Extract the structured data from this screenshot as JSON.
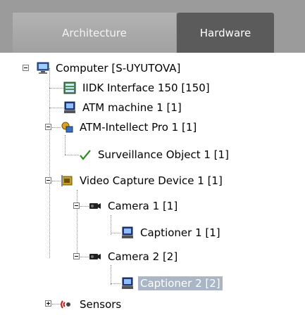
{
  "tabs": {
    "architecture": "Architecture",
    "hardware": "Hardware"
  },
  "tree": {
    "computer": "Computer [S-UYUTOVA]",
    "iidk": "IIDK Interface 150 [150]",
    "atm_machine": "ATM machine 1 [1]",
    "atm_intellect": "ATM-Intellect Pro 1 [1]",
    "surveillance": "Surveillance Object 1 [1]",
    "video_capture": "Video Capture Device 1 [1]",
    "camera1": "Camera 1 [1]",
    "captioner1": "Captioner 1 [1]",
    "camera2": "Camera 2 [2]",
    "captioner2": "Captioner 2 [2]",
    "sensors": "Sensors"
  },
  "colors": {
    "tabbar_bg": "#9b9b9b",
    "active_tab": "#5b5b5b",
    "selection": "#aab5c6"
  }
}
